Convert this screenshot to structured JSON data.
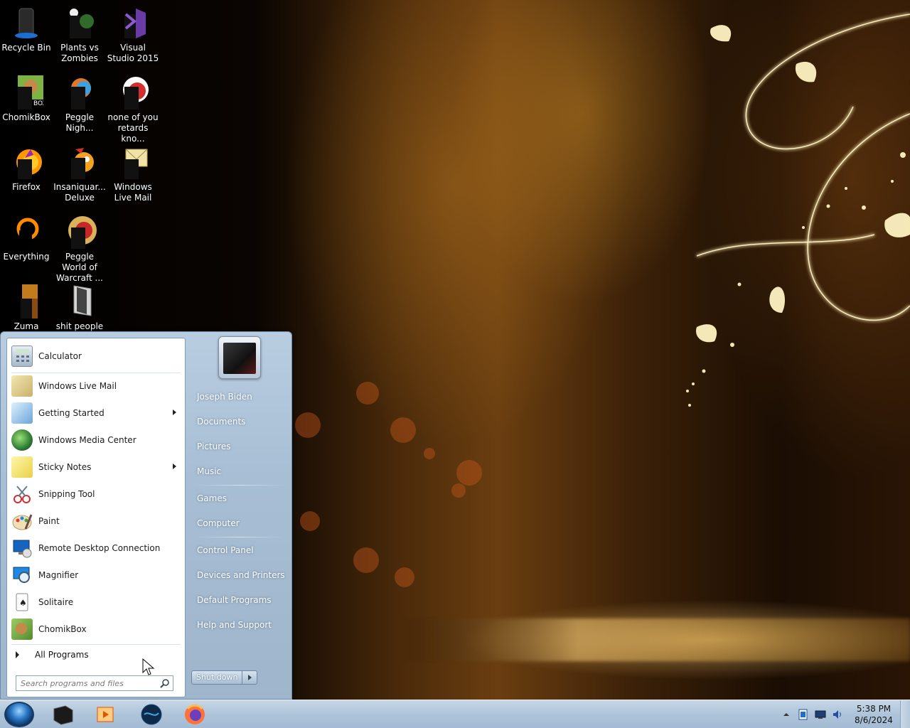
{
  "desktop": {
    "icons": [
      {
        "label": "Recycle Bin",
        "icon": "recycle-bin-icon"
      },
      {
        "label": "Plants vs Zombies",
        "icon": "plants-vs-zombies-icon"
      },
      {
        "label": "Visual Studio 2015",
        "icon": "visual-studio-icon"
      },
      {
        "label": "ChomikBox",
        "icon": "chomikbox-icon"
      },
      {
        "label": "Peggle Nigh...",
        "icon": "peggle-nights-icon"
      },
      {
        "label": "none of you retards kno...",
        "icon": "app-icon"
      },
      {
        "label": "Firefox",
        "icon": "firefox-icon"
      },
      {
        "label": "Insaniquar... Deluxe",
        "icon": "insaniquarium-icon"
      },
      {
        "label": "Windows Live Mail",
        "icon": "windows-live-mail-icon"
      },
      {
        "label": "Everything",
        "icon": "everything-search-icon"
      },
      {
        "label": "Peggle World of Warcraft ...",
        "icon": "peggle-wow-icon"
      },
      {
        "label": "Zuma Deluxe",
        "icon": "zuma-deluxe-icon"
      },
      {
        "label": "shit people",
        "icon": "folder-icon"
      }
    ]
  },
  "start_menu": {
    "pinned": [
      {
        "label": "Calculator",
        "icon": "calculator-icon"
      }
    ],
    "programs": [
      {
        "label": "Windows Live Mail",
        "icon": "windows-live-mail-icon",
        "submenu": false
      },
      {
        "label": "Getting Started",
        "icon": "getting-started-icon",
        "submenu": true
      },
      {
        "label": "Windows Media Center",
        "icon": "windows-media-center-icon",
        "submenu": false
      },
      {
        "label": "Sticky Notes",
        "icon": "sticky-notes-icon",
        "submenu": true
      },
      {
        "label": "Snipping Tool",
        "icon": "snipping-tool-icon",
        "submenu": false
      },
      {
        "label": "Paint",
        "icon": "paint-icon",
        "submenu": false
      },
      {
        "label": "Remote Desktop Connection",
        "icon": "remote-desktop-icon",
        "submenu": false
      },
      {
        "label": "Magnifier",
        "icon": "magnifier-icon",
        "submenu": false
      },
      {
        "label": "Solitaire",
        "icon": "solitaire-icon",
        "submenu": false
      },
      {
        "label": "ChomikBox",
        "icon": "chomikbox-icon",
        "submenu": false
      }
    ],
    "all_programs_label": "All Programs",
    "search_placeholder": "Search programs and files",
    "right_links": [
      "Joseph Biden",
      "Documents",
      "Pictures",
      "Music",
      "Games",
      "Computer",
      "Control Panel",
      "Devices and Printers",
      "Default Programs",
      "Help and Support"
    ],
    "shutdown_label": "Shut down"
  },
  "taskbar": {
    "apps": [
      "terminal-icon",
      "media-player-icon",
      "globe-icon",
      "firefox-icon"
    ],
    "clock_time": "5:38 PM",
    "clock_date": "8/6/2024",
    "colors": {
      "taskbar": "#aec4da",
      "start_menu": "#a7bed4"
    }
  }
}
